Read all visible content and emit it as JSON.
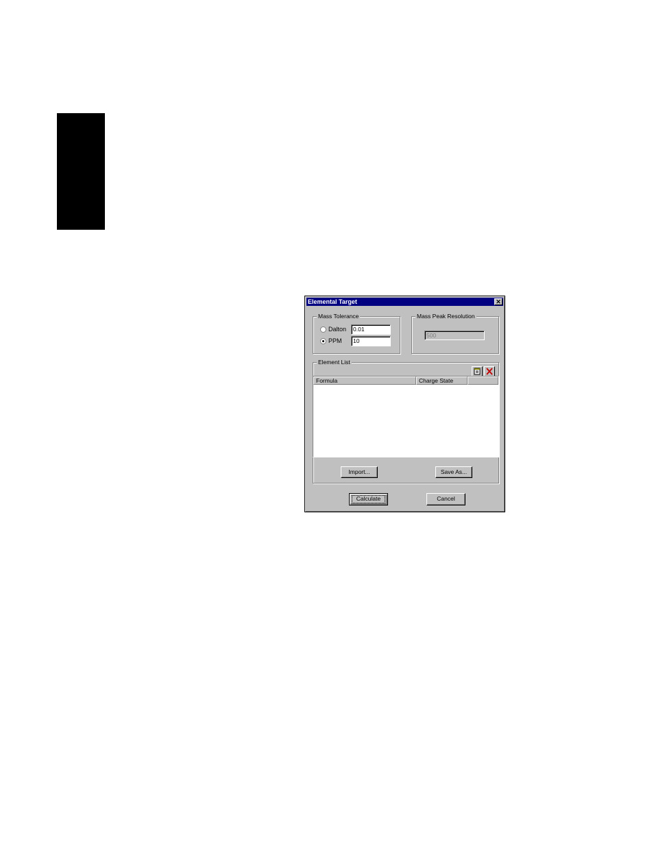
{
  "dialog": {
    "title": "Elemental Target",
    "close_glyph": "✕",
    "mass_tolerance": {
      "label": "Mass Tolerance",
      "dalton_label": "Dalton",
      "dalton_value": "0.01",
      "ppm_label": "PPM",
      "ppm_value": "10",
      "selected": "PPM"
    },
    "mass_peak_resolution": {
      "label": "Mass Peak Resolution",
      "value": "500"
    },
    "element_list": {
      "label": "Element List",
      "columns": [
        "Formula",
        "Charge State",
        ""
      ],
      "rows": [],
      "import_label": "Import...",
      "save_as_label": "Save As..."
    },
    "calculate_label": "Calculate",
    "cancel_label": "Cancel"
  },
  "icons": {
    "close": "close-icon",
    "new_row": "new-item-icon",
    "delete": "delete-icon"
  },
  "colors": {
    "titlebar": "#000080",
    "dialog_face": "#c0c0c0",
    "side_tab": "#000000"
  }
}
